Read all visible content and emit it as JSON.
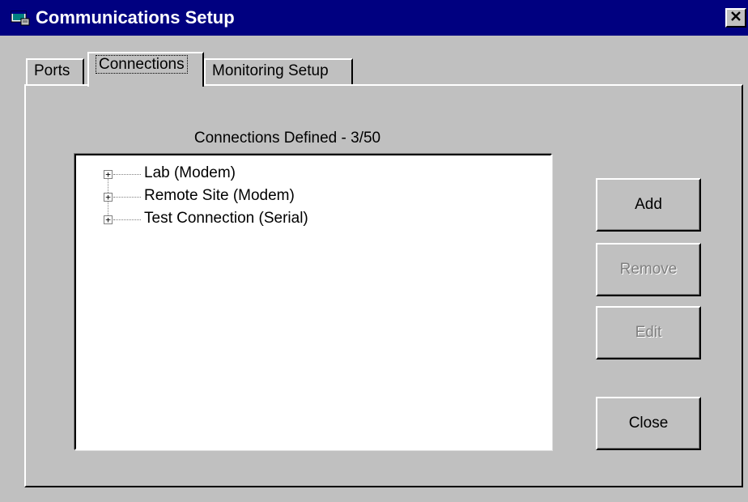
{
  "window": {
    "title": "Communications Setup",
    "close_glyph": "✕"
  },
  "tabs": [
    {
      "label": "Ports",
      "active": false
    },
    {
      "label": "Connections",
      "active": true
    },
    {
      "label": "Monitoring Setup",
      "active": false
    }
  ],
  "connections": {
    "caption": "Connections Defined - 3/50",
    "items": [
      {
        "label": "Lab (Modem)",
        "expander": "+"
      },
      {
        "label": "Remote Site (Modem)",
        "expander": "+"
      },
      {
        "label": "Test Connection (Serial)",
        "expander": "+"
      }
    ]
  },
  "buttons": {
    "add": "Add",
    "remove": "Remove",
    "edit": "Edit",
    "close": "Close"
  },
  "icons": {
    "app": "app-window-icon",
    "close": "close-icon"
  },
  "colors": {
    "titlebar": "#000080",
    "face": "#c0c0c0",
    "disabled_text": "#808080"
  }
}
